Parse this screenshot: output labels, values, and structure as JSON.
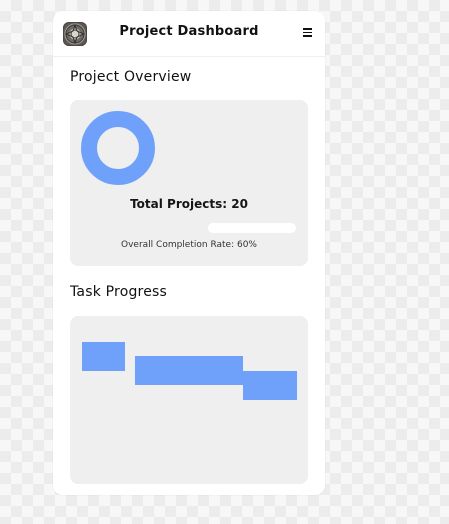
{
  "header": {
    "title": "Project Dashboard",
    "logo_icon": "medallion-logo-icon",
    "menu_icon": "hamburger-menu-icon"
  },
  "overview": {
    "title": "Project Overview",
    "total_projects_label": "Total Projects: 20",
    "completion_label": "Overall Completion Rate: 60%",
    "completion_rate": 0.6,
    "donut_color": "#6fa1fb"
  },
  "tasks": {
    "title": "Task Progress",
    "bar_color": "#6fa1fb",
    "bars": [
      {
        "name": "task-bar-1"
      },
      {
        "name": "task-bar-2"
      },
      {
        "name": "task-bar-3"
      }
    ]
  },
  "colors": {
    "accent": "#6fa1fb",
    "card_bg": "#efefef",
    "panel_bg": "#ffffff"
  }
}
